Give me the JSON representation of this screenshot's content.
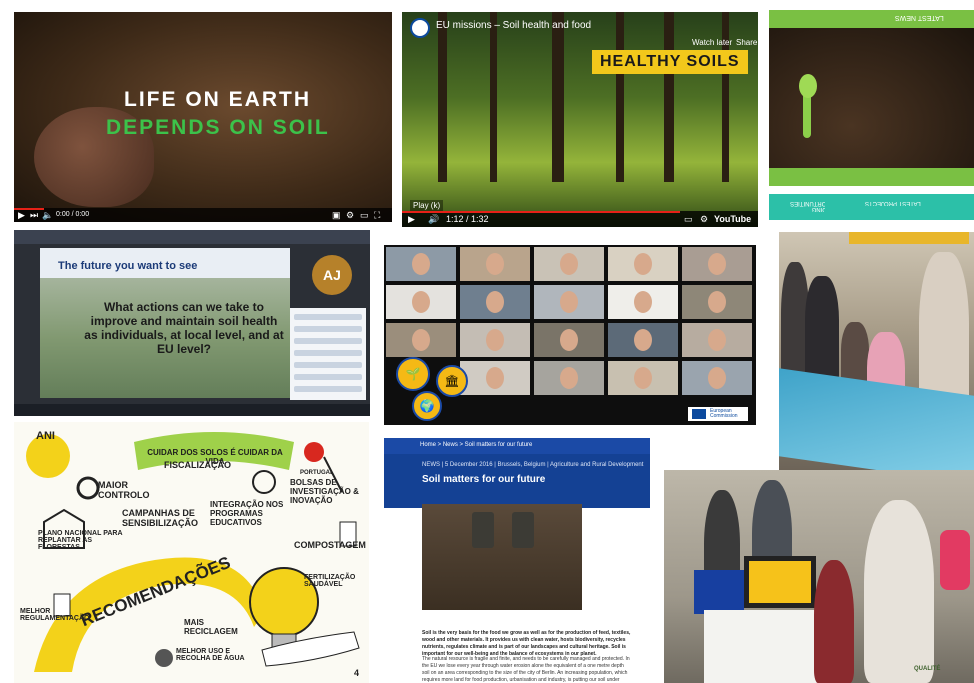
{
  "tile1": {
    "line1": "LIFE ON EARTH",
    "line2": "DEPENDS ON SOIL",
    "time": "0:00 / 0:00"
  },
  "tile2": {
    "video_title": "EU missions – Soil health and food",
    "banner": "HEALTHY SOILS",
    "watch_later": "Watch later",
    "share": "Share",
    "play_hint": "Play (k)",
    "time": "1:12 / 1:32",
    "youtube": "YouTube"
  },
  "tile3": {
    "header": "LATEST NEWS",
    "projects": "LATEST PROJECTS",
    "funding": "FUNDING OPPORTUNITIES"
  },
  "tile4": {
    "slide_title": "The future you want to see",
    "question": "What actions can we take to improve and maintain soil health as individuals, at local level, and at EU level?",
    "avatar": "AJ"
  },
  "tile5": {
    "logo_text": "European Commission"
  },
  "tile7": {
    "name": "ANI",
    "title": "CUIDAR DOS SOLOS É CUIDAR DA VIDA",
    "country": "PORTUGAL",
    "items": [
      "FISCALIZAÇÃO",
      "MAIOR CONTROLO",
      "BOLSAS DE INVESTIGAÇÃO & INOVAÇÃO",
      "CAMPANHAS DE SENSIBILIZAÇÃO",
      "INTEGRAÇÃO NOS PROGRAMAS EDUCATIVOS",
      "PLANO NACIONAL PARA REPLANTAR AS FLORESTAS",
      "COMPOSTAGEM",
      "RECOMENDAÇÕES",
      "FERTILIZAÇÃO SAUDÁVEL",
      "MELHOR REGULAMENTAÇÃO",
      "MAIS RECICLAGEM",
      "MELHOR USO E RECOLHA DE ÁGUA"
    ],
    "page": "4"
  },
  "tile8": {
    "breadcrumb": "Home  >  News  >  Soil matters for our future",
    "meta": "NEWS  |  5 December 2016  |  Brussels, Belgium  |  Agriculture and Rural Development",
    "title": "Soil matters for our future",
    "para1": "Soil is the very basis for the food we grow as well as for the production of feed, textiles, wood and other materials. It provides us with clean water, hosts biodiversity, recycles nutrients, regulates climate and is part of our landscapes and cultural heritage. Soil is important for our well-being and the balance of ecosystems in our planet.",
    "para2": "The natural resource is fragile and finite, and needs to be carefully managed and protected. In the EU we lose every year through water erosion alone the equivalent of a one metre depth soil on an area corresponding to the size of the city of Berlin. An increasing population, which requires more land for food production, urbanisation and industry, is putting our soil under additional pressure."
  },
  "tile9": {
    "box_label": "QUALITÉ"
  },
  "colors": {
    "eu_blue": "#144194",
    "soil_green": "#3cc24a",
    "banner_yellow": "#f2c81b",
    "lime": "#7ac043"
  }
}
